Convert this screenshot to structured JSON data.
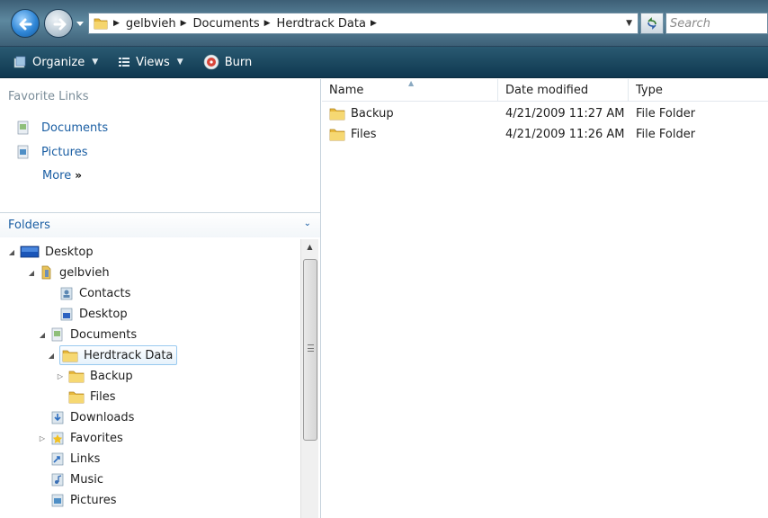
{
  "address": {
    "crumbs": [
      "gelbvieh",
      "Documents",
      "Herdtrack Data"
    ],
    "search_placeholder": "Search"
  },
  "toolbar": {
    "organize_label": "Organize",
    "views_label": "Views",
    "burn_label": "Burn"
  },
  "favorites": {
    "header": "Favorite Links",
    "items": [
      {
        "label": "Documents",
        "icon": "documents-icon"
      },
      {
        "label": "Pictures",
        "icon": "pictures-icon"
      }
    ],
    "more_label": "More"
  },
  "folders": {
    "header": "Folders",
    "tree": [
      {
        "label": "Desktop",
        "icon": "desktop-icon",
        "expanded": true
      },
      {
        "label": "gelbvieh",
        "icon": "user-folder-icon",
        "expanded": true
      },
      {
        "label": "Contacts",
        "icon": "contacts-icon"
      },
      {
        "label": "Desktop",
        "icon": "desktop-folder-icon"
      },
      {
        "label": "Documents",
        "icon": "documents-icon",
        "expanded": true
      },
      {
        "label": "Herdtrack Data",
        "icon": "folder-icon",
        "expanded": true,
        "selected": true
      },
      {
        "label": "Backup",
        "icon": "folder-icon",
        "collapsed": true
      },
      {
        "label": "Files",
        "icon": "folder-icon"
      },
      {
        "label": "Downloads",
        "icon": "downloads-icon"
      },
      {
        "label": "Favorites",
        "icon": "favorites-icon",
        "collapsed": true
      },
      {
        "label": "Links",
        "icon": "links-icon"
      },
      {
        "label": "Music",
        "icon": "music-icon"
      },
      {
        "label": "Pictures",
        "icon": "pictures-icon"
      }
    ]
  },
  "filelist": {
    "columns": [
      "Name",
      "Date modified",
      "Type"
    ],
    "rows": [
      {
        "name": "Backup",
        "date": "4/21/2009 11:27 AM",
        "type": "File Folder"
      },
      {
        "name": "Files",
        "date": "4/21/2009 11:26 AM",
        "type": "File Folder"
      }
    ]
  },
  "colors": {
    "link": "#1a5ea3",
    "toolbar": "#1c4960",
    "selection_border": "#99c9ef"
  }
}
